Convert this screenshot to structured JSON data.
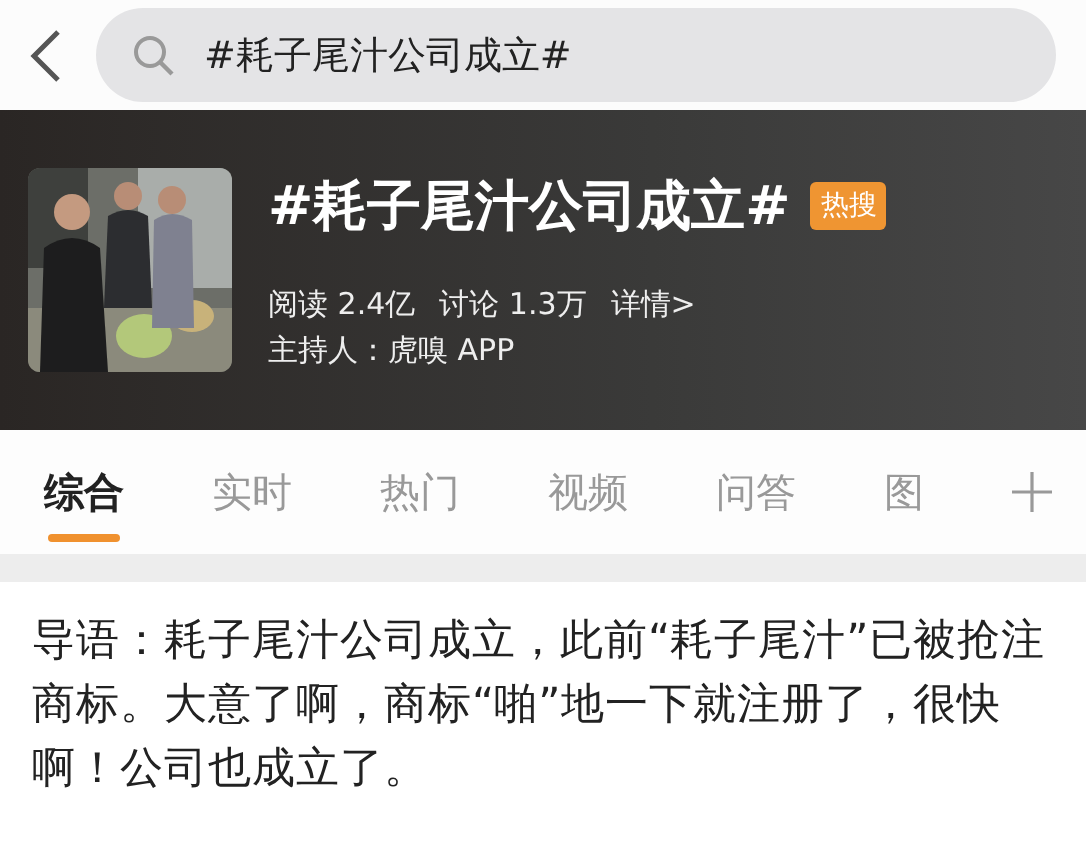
{
  "search": {
    "value": "#耗子尾汁公司成立#"
  },
  "topic": {
    "title": "#耗子尾汁公司成立#",
    "badge": "热搜",
    "stats": [
      {
        "label": "阅读",
        "value": "2.4亿"
      },
      {
        "label": "讨论",
        "value": "1.3万"
      }
    ],
    "details_link": "详情>",
    "host": "主持人：虎嗅 APP"
  },
  "tabs": [
    {
      "label": "综合",
      "selected": true
    },
    {
      "label": "实时",
      "selected": false
    },
    {
      "label": "热门",
      "selected": false
    },
    {
      "label": "视频",
      "selected": false
    },
    {
      "label": "问答",
      "selected": false
    },
    {
      "label": "图",
      "selected": false
    }
  ],
  "intro": "导语：耗子尾汁公司成立，此前“耗子尾汁”已被抢注商标。大意了啊，商标“啪”地一下就注册了，很快啊！公司也成立了。"
}
